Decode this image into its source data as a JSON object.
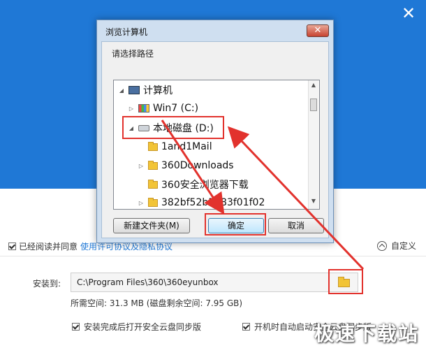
{
  "dialog": {
    "title": "浏览计算机",
    "close_label": "✕",
    "prompt": "请选择路径",
    "tree": [
      {
        "label": "计算机",
        "icon": "computer-icon"
      },
      {
        "label": "Win7 (C:)",
        "icon": "drive-c-icon"
      },
      {
        "label": "本地磁盘 (D:)",
        "icon": "disk-icon"
      },
      {
        "label": "1and1Mail",
        "icon": "folder-icon"
      },
      {
        "label": "360Downloads",
        "icon": "folder-icon"
      },
      {
        "label": "360安全浏览器下载",
        "icon": "folder-icon"
      },
      {
        "label": "382bf52b5883f01f02",
        "icon": "folder-icon"
      }
    ],
    "buttons": {
      "new_folder": "新建文件夹(M)",
      "ok": "确定",
      "cancel": "取消"
    }
  },
  "installer": {
    "close_label": "✕",
    "agree_text": "已经阅读并同意",
    "agree_link": "使用许可协议及隐私协议",
    "custom_label": "自定义",
    "install_to_label": "安装到:",
    "install_path": "C:\\Program Files\\360\\360eyunbox",
    "space_text": "所需空间: 31.3 MB (磁盘剩余空间: 7.95 GB)",
    "option1": "安装完成后打开安全云盘同步版",
    "option2": "开机时自动启动安全云盘同步版"
  },
  "watermark": "极速下载站",
  "colors": {
    "header_blue": "#1f78d6",
    "highlight_red": "#e2322d"
  }
}
